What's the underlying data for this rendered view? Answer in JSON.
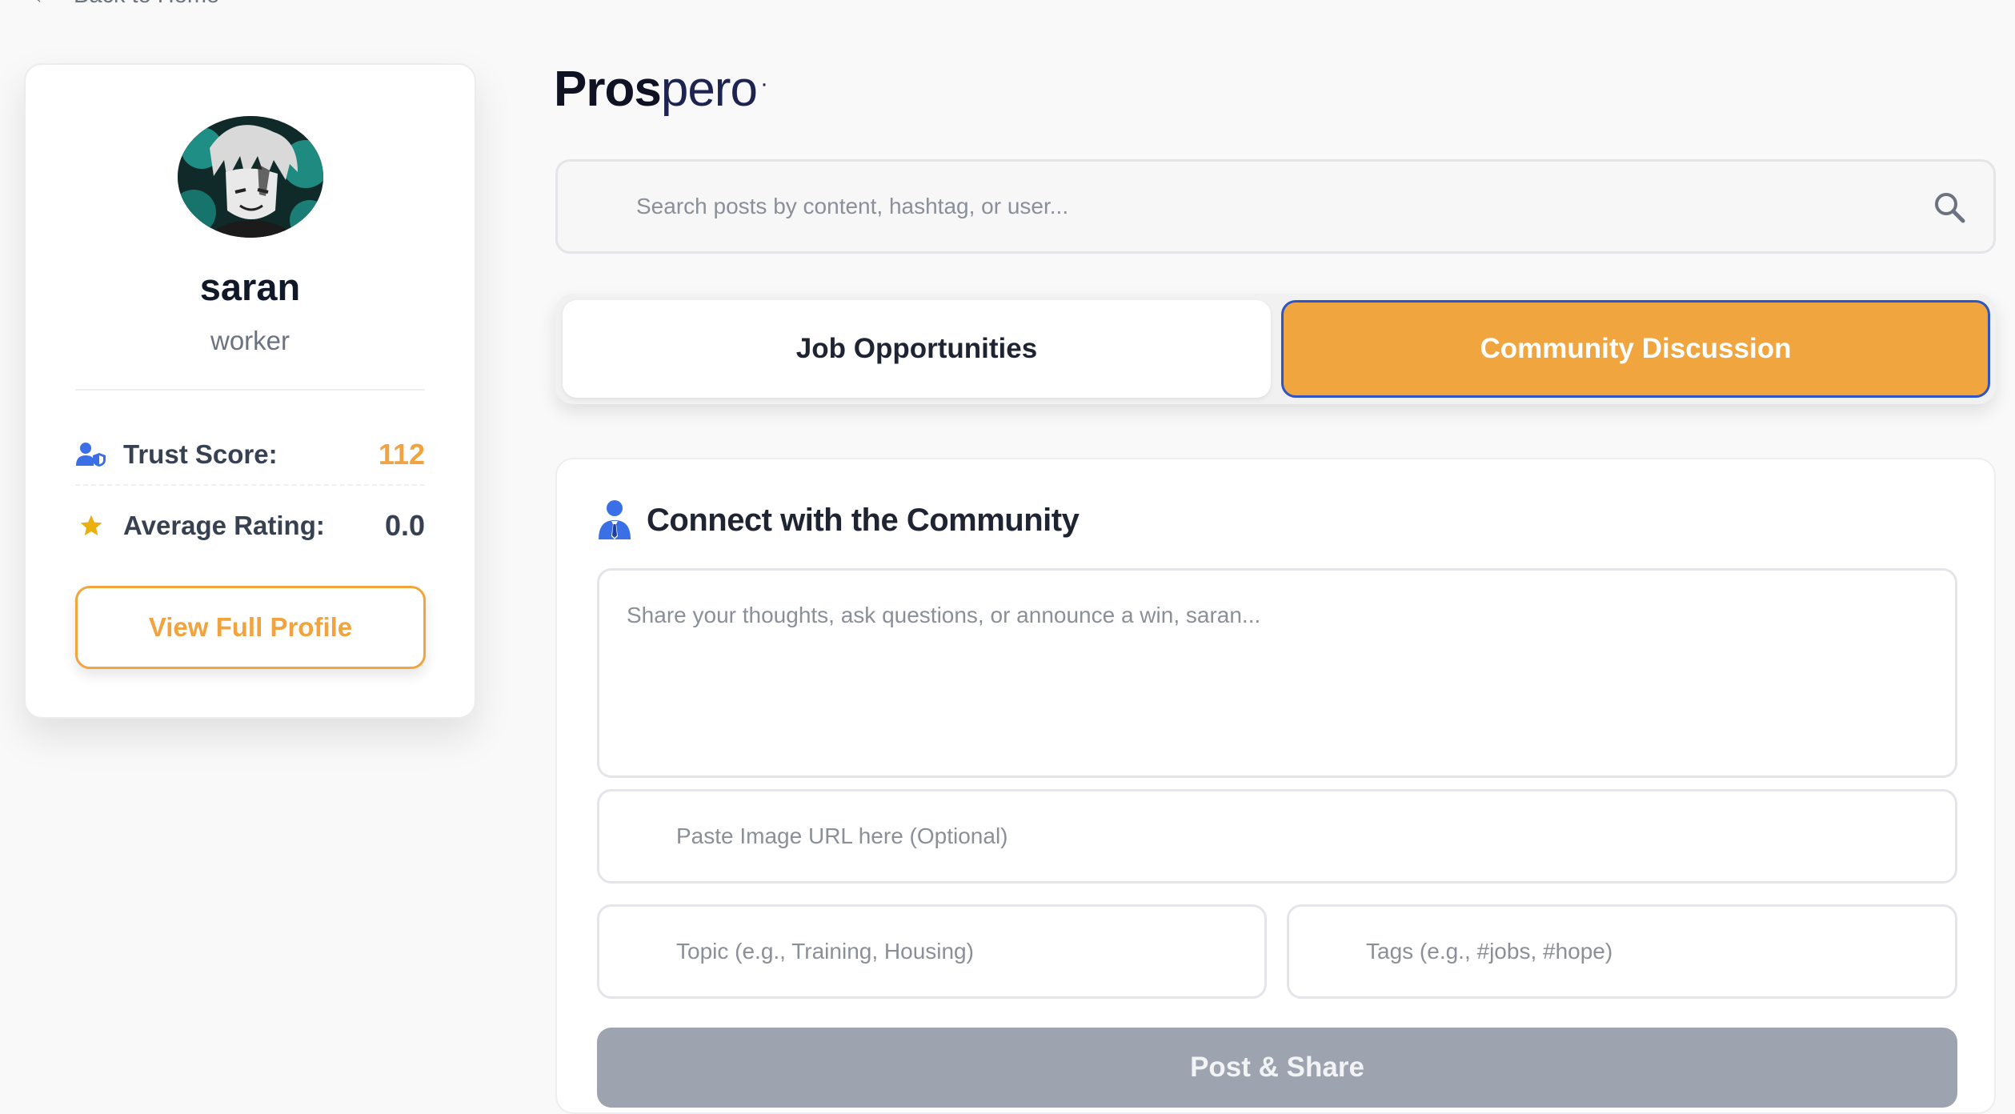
{
  "nav": {
    "back_label": "Back to Home"
  },
  "profile": {
    "name": "saran",
    "role": "worker",
    "trust_label": "Trust Score:",
    "trust_value": "112",
    "rating_label": "Average Rating:",
    "rating_value": "0.0",
    "profile_button": "View Full Profile"
  },
  "brand": {
    "bold": "Pros",
    "light": "pero",
    "dot": "·"
  },
  "search": {
    "placeholder": "Search posts by content, hashtag, or user..."
  },
  "tabs": [
    {
      "label": "Job Opportunities",
      "active": false
    },
    {
      "label": "Community Discussion",
      "active": true
    }
  ],
  "composer": {
    "title": "Connect with the Community",
    "message_placeholder": "Share your thoughts, ask questions, or announce a win, saran...",
    "image_placeholder": "Paste Image URL here (Optional)",
    "topic_placeholder": "Topic (e.g., Training, Housing)",
    "tags_placeholder": "Tags (e.g., #jobs, #hope)",
    "submit_label": "Post & Share"
  },
  "colors": {
    "accent": "#f0a53e",
    "active_tab_border": "#2f55c4",
    "icon_blue": "#3b6fe6",
    "button_disabled": "#9da3af"
  }
}
